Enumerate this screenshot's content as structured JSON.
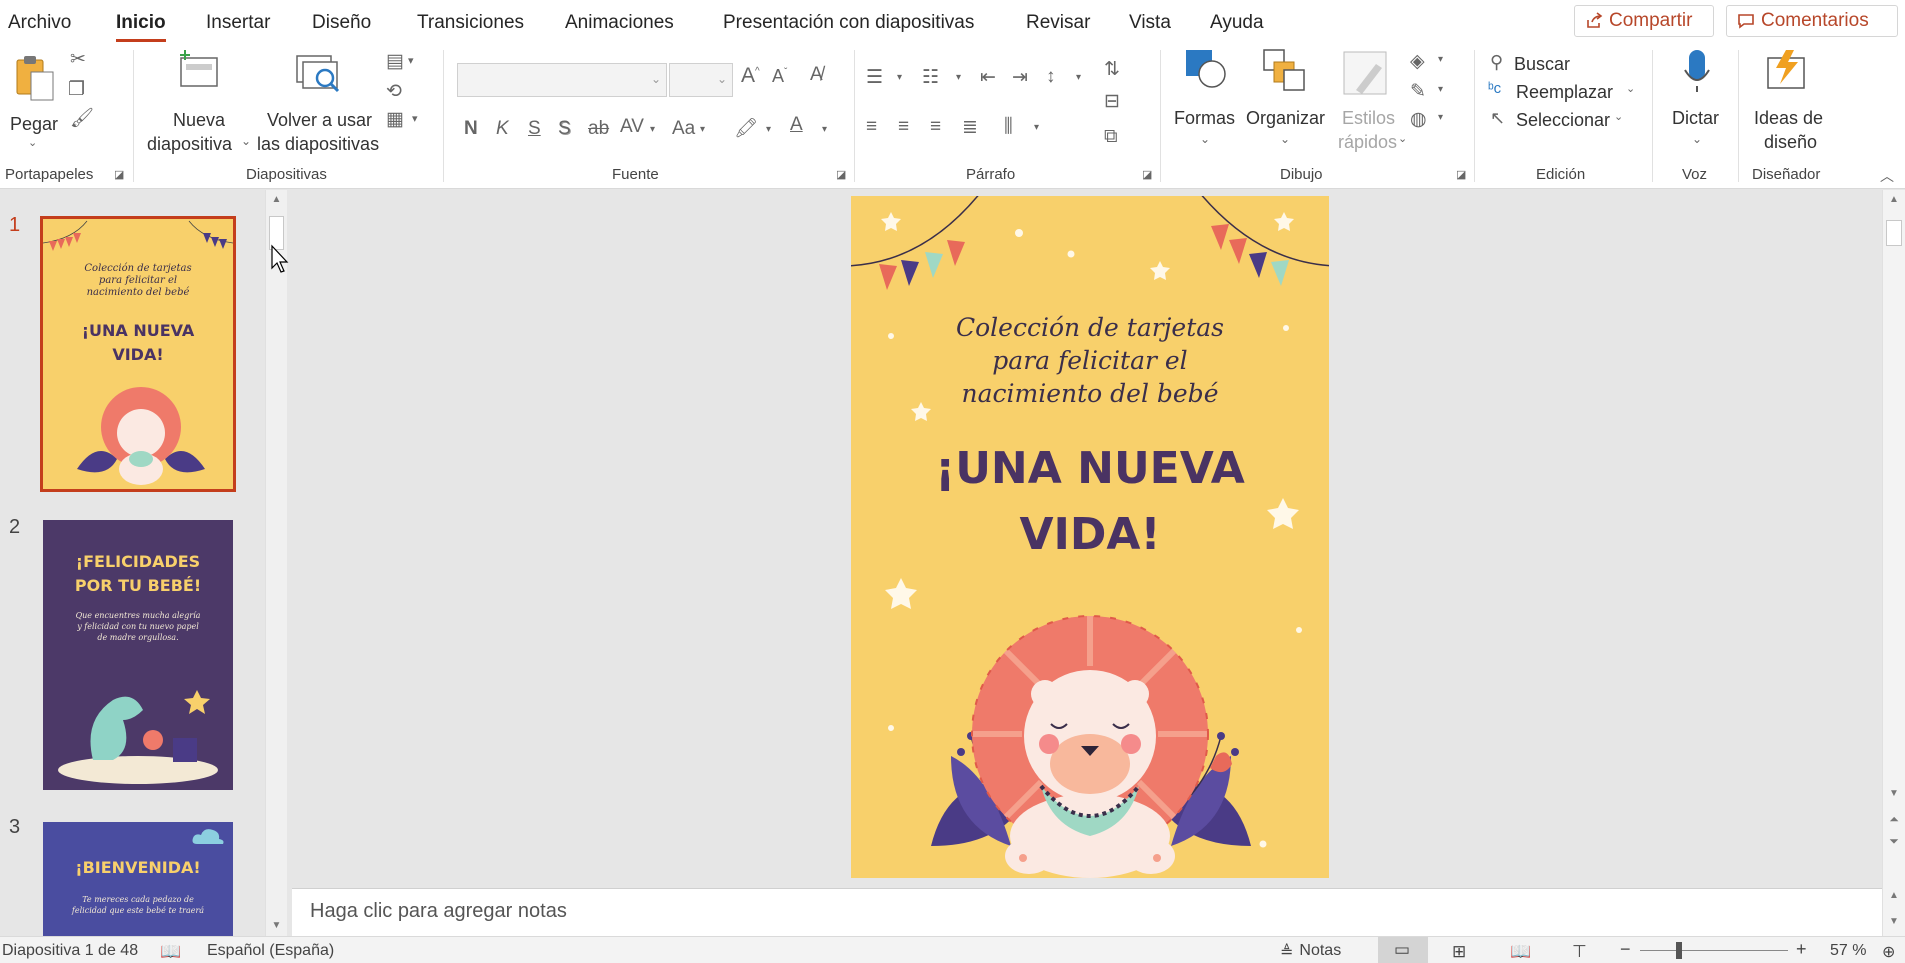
{
  "tabs": [
    "Archivo",
    "Inicio",
    "Insertar",
    "Diseño",
    "Transiciones",
    "Animaciones",
    "Presentación con diapositivas",
    "Revisar",
    "Vista",
    "Ayuda"
  ],
  "share_label": "Compartir",
  "comments_label": "Comentarios",
  "ribbon": {
    "clipboard": {
      "paste": "Pegar",
      "group": "Portapapeles"
    },
    "slides": {
      "new_slide_1": "Nueva",
      "new_slide_2": "diapositiva",
      "reuse_1": "Volver a usar",
      "reuse_2": "las diapositivas",
      "group": "Diapositivas"
    },
    "font": {
      "group": "Fuente",
      "bold": "N",
      "italic": "K",
      "underline": "S",
      "shadow": "S",
      "strike": "ab",
      "spacing": "AV",
      "case": "Aa",
      "grow": "A",
      "shrink": "A"
    },
    "paragraph": {
      "group": "Párrafo"
    },
    "drawing": {
      "shapes": "Formas",
      "arrange": "Organizar",
      "quick_styles_1": "Estilos",
      "quick_styles_2": "rápidos",
      "group": "Dibujo"
    },
    "editing": {
      "find": "Buscar",
      "replace": "Reemplazar",
      "select": "Seleccionar",
      "group": "Edición"
    },
    "voice": {
      "dictate": "Dictar",
      "group": "Voz"
    },
    "designer": {
      "ideas_1": "Ideas de",
      "ideas_2": "diseño",
      "group": "Diseñador"
    }
  },
  "thumbnails": [
    {
      "number": "1",
      "line1": "Colección de tarjetas",
      "line2": "para felicitar el",
      "line3": "nacimiento del bebé",
      "title1": "¡UNA NUEVA",
      "title2": "VIDA!"
    },
    {
      "number": "2",
      "title1": "¡FELICIDADES",
      "title2": "POR TU BEBÉ!",
      "line1": "Que encuentres mucha alegría",
      "line2": "y felicidad con tu nuevo papel",
      "line3": "de madre orgullosa."
    },
    {
      "number": "3",
      "title1": "¡BIENVENIDA!",
      "line1": "Te mereces cada pedazo de",
      "line2": "felicidad que este bebé te traerá"
    }
  ],
  "slide": {
    "subtitle1": "Colección de tarjetas",
    "subtitle2": "para felicitar el",
    "subtitle3": "nacimiento del bebé",
    "title1": "¡UNA NUEVA",
    "title2": "VIDA!"
  },
  "notes_placeholder": "Haga clic para agregar notas",
  "status": {
    "slide_count": "Diapositiva 1 de 48",
    "language": "Español (España)",
    "notes": "Notas",
    "zoom": "57 %",
    "minus": "−",
    "plus": "+"
  },
  "colors": {
    "accent": "#c43e1c",
    "slide_bg": "#f8d06b",
    "title": "#4a3363",
    "purple": "#4a3b86"
  }
}
